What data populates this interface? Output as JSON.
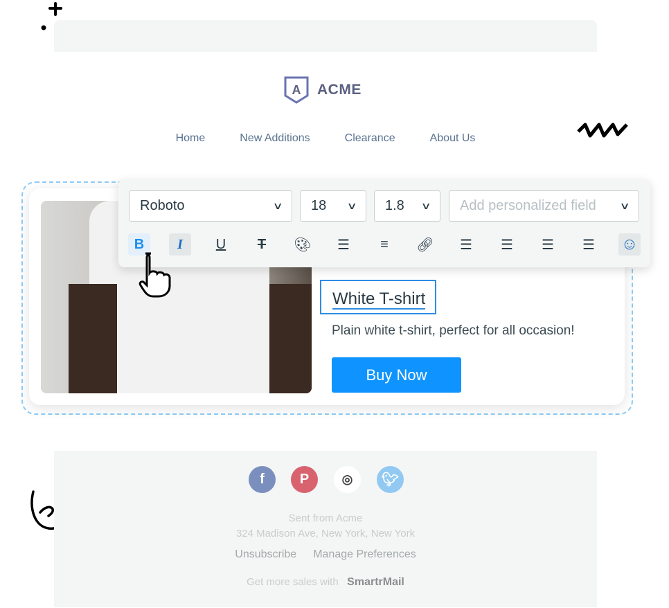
{
  "brand": {
    "name": "ACME",
    "logo_letter": "A"
  },
  "nav": [
    "Home",
    "New Additions",
    "Clearance",
    "About Us"
  ],
  "toolbar": {
    "font": "Roboto",
    "size": "18",
    "line_height": "1.8",
    "personalized_placeholder": "Add personalized field",
    "tools": [
      "bold",
      "italic",
      "underline",
      "strikethrough",
      "color-palette",
      "bullet-list",
      "numbered-list",
      "link",
      "align-left",
      "align-center",
      "align-right",
      "justify",
      "emoji"
    ]
  },
  "product": {
    "title": "White T-shirt",
    "description": "Plain white t-shirt, perfect for all occasion!",
    "button": "Buy Now"
  },
  "footer": {
    "social": [
      "facebook",
      "pinterest",
      "instagram",
      "twitter"
    ],
    "sent_from": "Sent from Acme",
    "address": "324 Madison Ave, New York, New York",
    "unsubscribe": "Unsubscribe",
    "manage": "Manage Preferences",
    "promo": "Get more sales with",
    "promo_brand": "SmartrMail"
  },
  "colors": {
    "accent": "#0f94ff",
    "selection": "#2d8de6",
    "dashed": "#8dcbf7"
  }
}
